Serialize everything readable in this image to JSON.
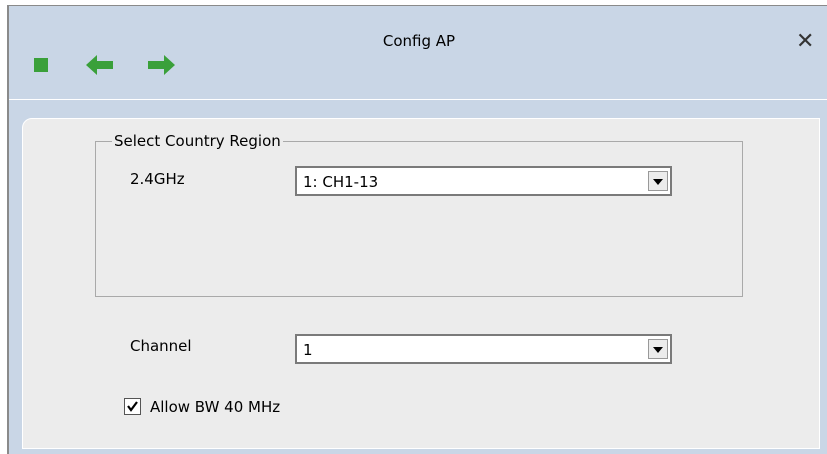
{
  "window": {
    "title": "Config AP",
    "close_label": "✕"
  },
  "toolbar": {
    "icons": [
      "stop-icon",
      "back-arrow-icon",
      "forward-arrow-icon"
    ],
    "accent_color": "#3aa03a"
  },
  "country_region": {
    "group_title": "Select Country Region",
    "band_label": "2.4GHz",
    "band_value": "1: CH1-13"
  },
  "channel": {
    "label": "Channel",
    "value": "1"
  },
  "allow_bw": {
    "label": "Allow BW 40 MHz",
    "checked": true
  }
}
